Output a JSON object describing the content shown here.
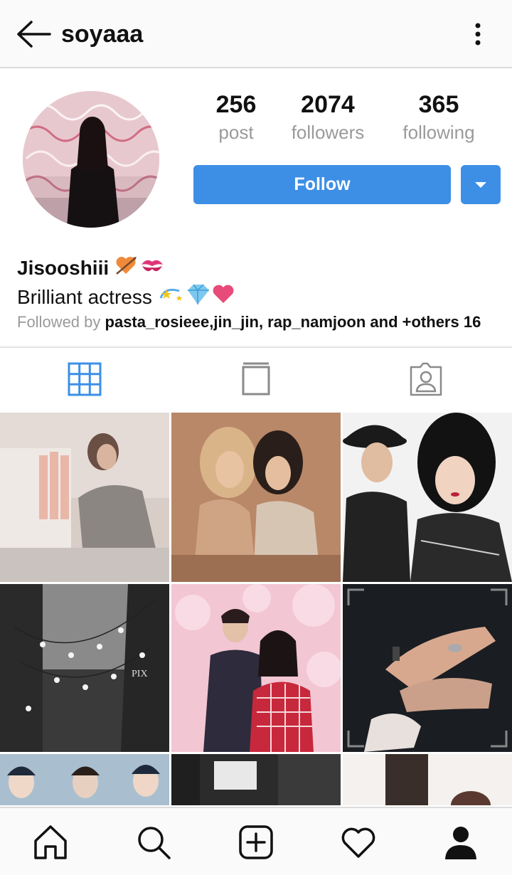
{
  "header": {
    "username": "soyaaa",
    "back_icon": "arrow-left-icon",
    "more_icon": "more-vertical-icon"
  },
  "profile": {
    "posts_count": "256",
    "posts_label": "post",
    "followers_count": "2074",
    "followers_label": "followers",
    "following_count": "365",
    "following_label": "following",
    "follow_button": "Follow",
    "display_name": "Jisooshiii",
    "bio": "Brilliant actress",
    "followed_by_prefix": "Followed by",
    "followed_by_names": "pasta_rosieee,jin_jin, rap_namjoon and +others 16"
  },
  "tabs": [
    {
      "icon": "grid-icon",
      "active": true
    },
    {
      "icon": "feed-list-icon",
      "active": false
    },
    {
      "icon": "tagged-person-icon",
      "active": false
    }
  ],
  "bottom_nav": [
    "home-icon",
    "search-icon",
    "add-post-icon",
    "heart-icon",
    "profile-icon"
  ],
  "colors": {
    "accent": "#3d8fe6",
    "muted_text": "#9a9a9a",
    "bar_background": "#fafafa"
  }
}
